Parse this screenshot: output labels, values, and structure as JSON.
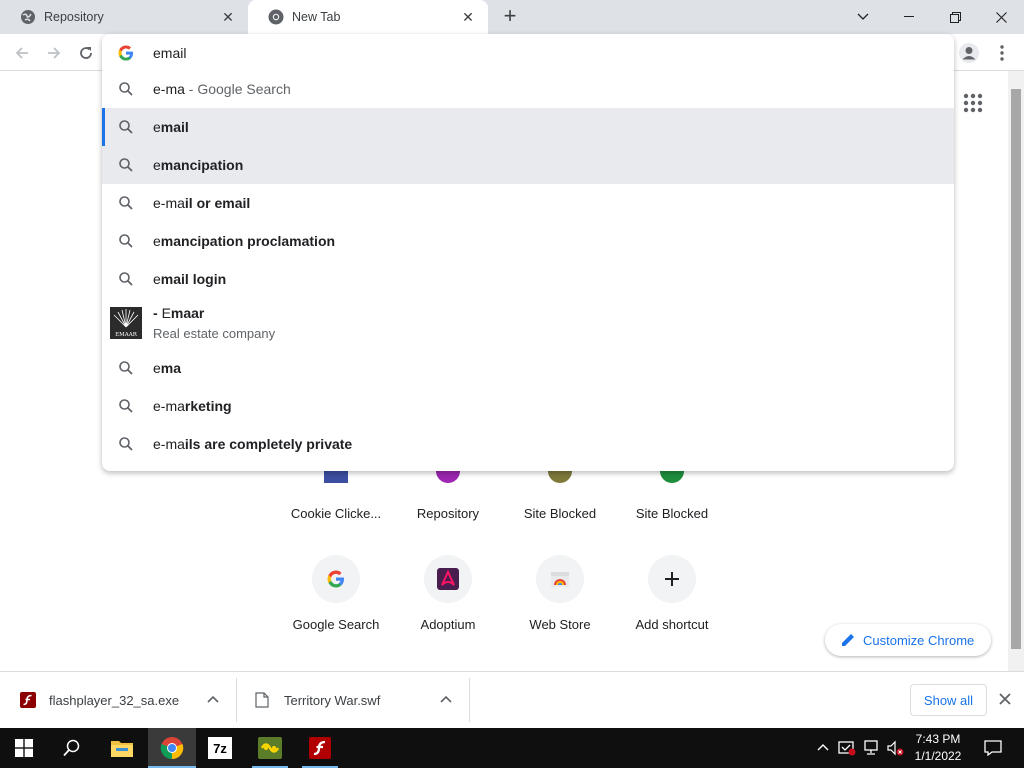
{
  "tabs": [
    {
      "title": "Repository",
      "active": false
    },
    {
      "title": "New Tab",
      "active": true
    }
  ],
  "omnibox": {
    "input": "email",
    "suggestions": [
      {
        "prefix": "e-ma",
        "bold": "",
        "suffix": " - Google Search",
        "type": "search"
      },
      {
        "prefix": "e",
        "bold": "mail",
        "suffix": "",
        "type": "search",
        "selected": true
      },
      {
        "prefix": "e",
        "bold": "mancipation",
        "suffix": "",
        "type": "search"
      },
      {
        "prefix": "e-ma",
        "bold": "il or email",
        "suffix": "",
        "type": "search"
      },
      {
        "prefix": "e",
        "bold": "mancipation proclamation",
        "suffix": "",
        "type": "search"
      },
      {
        "prefix": "e",
        "bold": "mail login",
        "suffix": "",
        "type": "search"
      },
      {
        "prefix": "e",
        "bold": "ma",
        "suffix": "",
        "type": "search"
      },
      {
        "prefix": "e-ma",
        "bold": "rketing",
        "suffix": "",
        "type": "search"
      },
      {
        "prefix": "e-ma",
        "bold": "ils are completely private",
        "suffix": "",
        "type": "search"
      }
    ],
    "entity": {
      "title_dash": "- ",
      "title_prefix": "E",
      "title_rest": "maar",
      "subtitle": "Real estate company",
      "logo_text": "EMAAR"
    }
  },
  "shortcuts": [
    {
      "label": "Cookie Clicke...",
      "icon": "cookie-clicker-icon"
    },
    {
      "label": "Repository",
      "icon": "repository-icon"
    },
    {
      "label": "Site Blocked",
      "icon": "site-blocked-icon"
    },
    {
      "label": "Site Blocked",
      "icon": "site-blocked-icon"
    },
    {
      "label": "Google Search",
      "icon": "google-icon"
    },
    {
      "label": "Adoptium",
      "icon": "adoptium-icon"
    },
    {
      "label": "Web Store",
      "icon": "web-store-icon"
    },
    {
      "label": "Add shortcut",
      "icon": "plus-icon"
    }
  ],
  "customize": {
    "label": "Customize Chrome"
  },
  "downloads": [
    {
      "name": "flashplayer_32_sa.exe",
      "icon": "flash-icon"
    },
    {
      "name": "Territory War.swf",
      "icon": "file-icon"
    }
  ],
  "shelf": {
    "show_all": "Show all"
  },
  "taskbar": {
    "time": "7:43 PM",
    "date": "1/1/2022",
    "sevenzip_label": "7z"
  },
  "colors": {
    "accent": "#1a73e8",
    "selection_bar": "#1a73e8",
    "taskbar_bg": "#0f0f0f"
  }
}
